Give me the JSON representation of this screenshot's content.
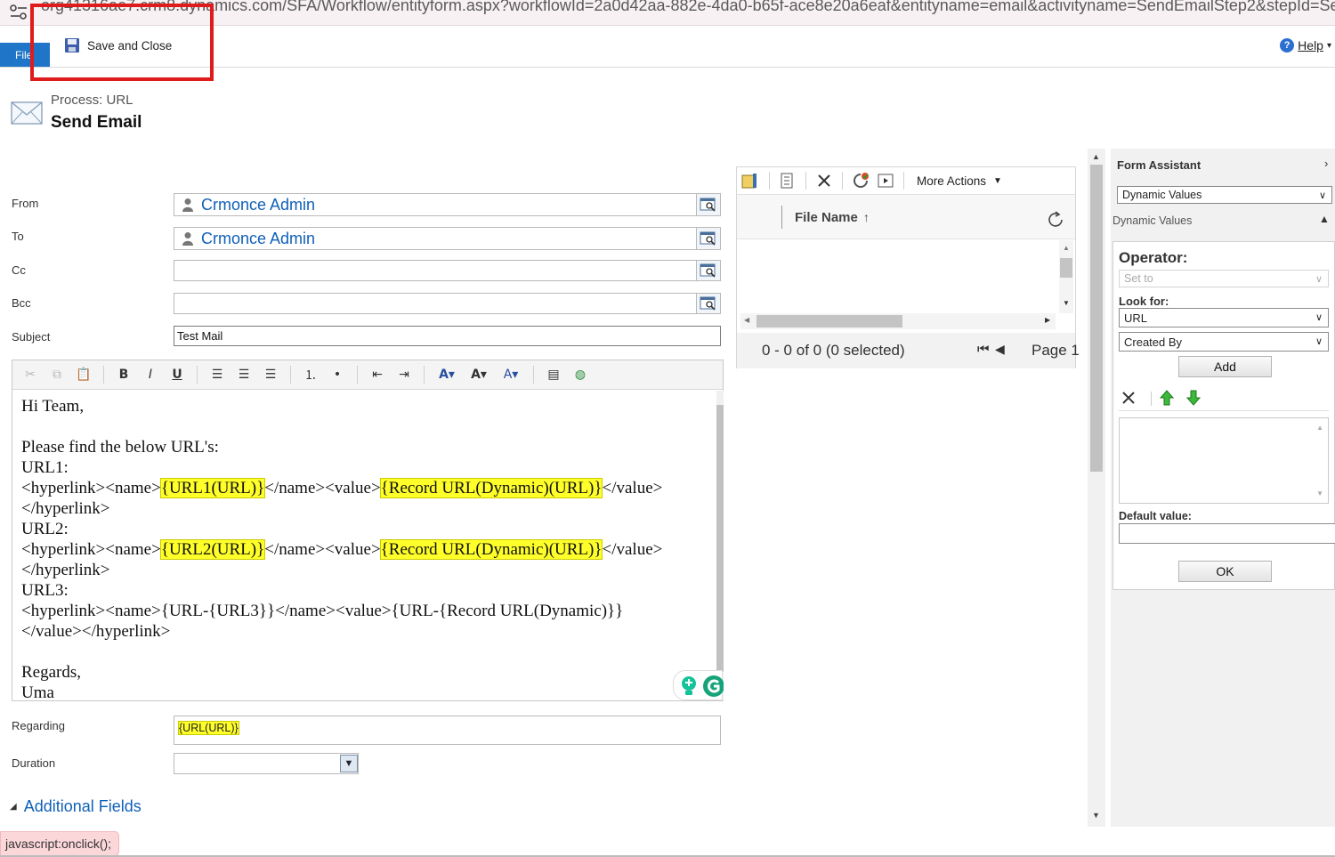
{
  "browser": {
    "url": "org41316ae7.crm8.dynamics.com/SFA/Workflow/entityform.aspx?workflowId=2a0d42aa-882e-4da0-b65f-ace8e20a6eaf&entityname=email&activityname=SendEmailStep2&stepId=Se..."
  },
  "ribbon": {
    "file_tab": "File",
    "save_close": "Save and Close",
    "help": "Help"
  },
  "header": {
    "process_label": "Process: URL",
    "title": "Send Email"
  },
  "form": {
    "from_label": "From",
    "from_value": "Crmonce Admin",
    "to_label": "To",
    "to_value": "Crmonce Admin",
    "cc_label": "Cc",
    "bcc_label": "Bcc",
    "subject_label": "Subject",
    "subject_value": "Test Mail",
    "regarding_label": "Regarding",
    "regarding_value": "{URL(URL)}",
    "duration_label": "Duration",
    "additional_fields": "Additional Fields"
  },
  "editor": {
    "greeting": "Hi Team,",
    "intro": "Please find the below URL's:",
    "url1_label": "URL1:",
    "url2_label": "URL2:",
    "url3_label": "URL3:",
    "hl_open": "<hyperlink><name>",
    "mid": "</name><value>",
    "val_close": "</value>",
    "hl_close": "</hyperlink>",
    "token_url1": "{URL1(URL)}",
    "token_url2": "{URL2(URL)}",
    "token_record": "{Record URL(Dynamic)(URL)}",
    "url3_line": "<hyperlink><name>{URL-{URL3}}</name><value>{URL-{Record URL(Dynamic)}}",
    "url3_close": "</value></hyperlink>",
    "regards": "Regards,",
    "signature": "Uma"
  },
  "attachments": {
    "more_actions": "More Actions",
    "file_name_col": "File Name",
    "count": "0 - 0 of 0 (0 selected)",
    "page": "Page 1"
  },
  "form_assistant": {
    "title": "Form Assistant",
    "selector": "Dynamic Values",
    "sub_title": "Dynamic Values",
    "operator_label": "Operator:",
    "operator_value": "Set to",
    "look_for_label": "Look for:",
    "look_for_value": "URL",
    "field_value": "Created By",
    "add_button": "Add",
    "default_value_label": "Default value:",
    "ok_button": "OK"
  },
  "status_bar": "javascript:onclick();",
  "colors": {
    "accent": "#1f76c9",
    "highlight": "#ffff2a",
    "red_box": "#e01b1b",
    "link": "#1060b8"
  }
}
